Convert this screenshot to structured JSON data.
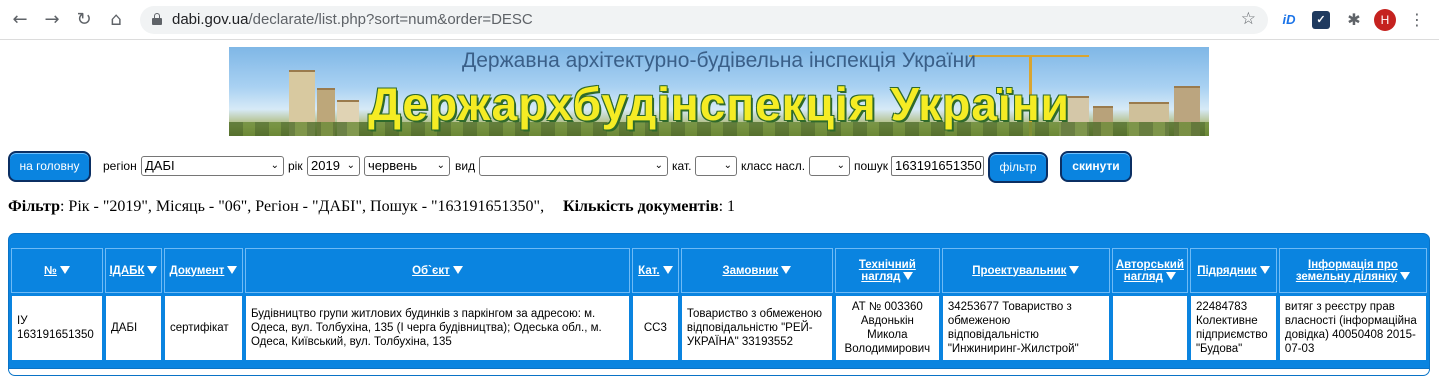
{
  "browser": {
    "url_host": "dabi.gov.ua",
    "url_path": "/declarate/list.php?sort=num&order=DESC",
    "avatar_letter": "H",
    "icons": [
      "back-icon",
      "forward-icon",
      "reload-icon",
      "home-icon",
      "lock-icon",
      "star-icon",
      "extension-icon",
      "puzzle-icon",
      "menu-icon"
    ]
  },
  "banner": {
    "subtitle": "Державна архітектурно-будівельна інспекція України",
    "title": "Держархбудінспекція України"
  },
  "filters": {
    "home_label": "на головну",
    "region_label": "регіон",
    "region_value": "ДАБІ",
    "year_label": "рік",
    "year_value": "2019",
    "month_value": "червень",
    "type_label": "вид",
    "type_value": "",
    "cat_label": "кат.",
    "cat_value": "",
    "class_label": "класс насл.",
    "class_value": "",
    "search_label": "пошук",
    "search_value": "163191651350",
    "filter_label": "фільтр",
    "reset_label": "скинути"
  },
  "summary": {
    "filter_heading": "Фільтр",
    "filter_text": ": Рік - \"2019\", Місяць - \"06\", Регіон - \"ДАБІ\", Пошук - \"163191651350\",",
    "count_heading": "Кількість документів",
    "count_text": ": 1"
  },
  "table": {
    "headers": [
      "№",
      "ІДАБК",
      "Документ",
      "Об`єкт",
      "Кат.",
      "Замовник",
      "Технічний нагляд",
      "Проектувальник",
      "Авторський нагляд",
      "Підрядник",
      "Інформація про земельну ділянку"
    ],
    "rows": [
      {
        "num": "ІУ 163191651350",
        "idabk": "ДАБІ",
        "doc": "сертифікат",
        "object": "Будівництво групи житлових будинків з паркінгом за адресою: м. Одеса, вул. Толбухіна, 135 (І черга будівництва); Одеська обл., м. Одеса, Київський, вул. Толбухіна, 135",
        "cat": "СС3",
        "customer": "Товариство з обмеженою відповідальністю \"РЕЙ-УКРАЇНА\" 33193552",
        "tech": "АТ № 003360 Авдонькін Микола Володимирович",
        "designer": "34253677 Товариство з обмеженою відповідальністю \"Инжиниринг-Жилстрой\"",
        "author": "",
        "contractor": "22484783 Колективне підприємство \"Будова\"",
        "land": "витяг з реєстру прав власності (інформаційна довідка) 40050408 2015-07-03"
      }
    ]
  }
}
